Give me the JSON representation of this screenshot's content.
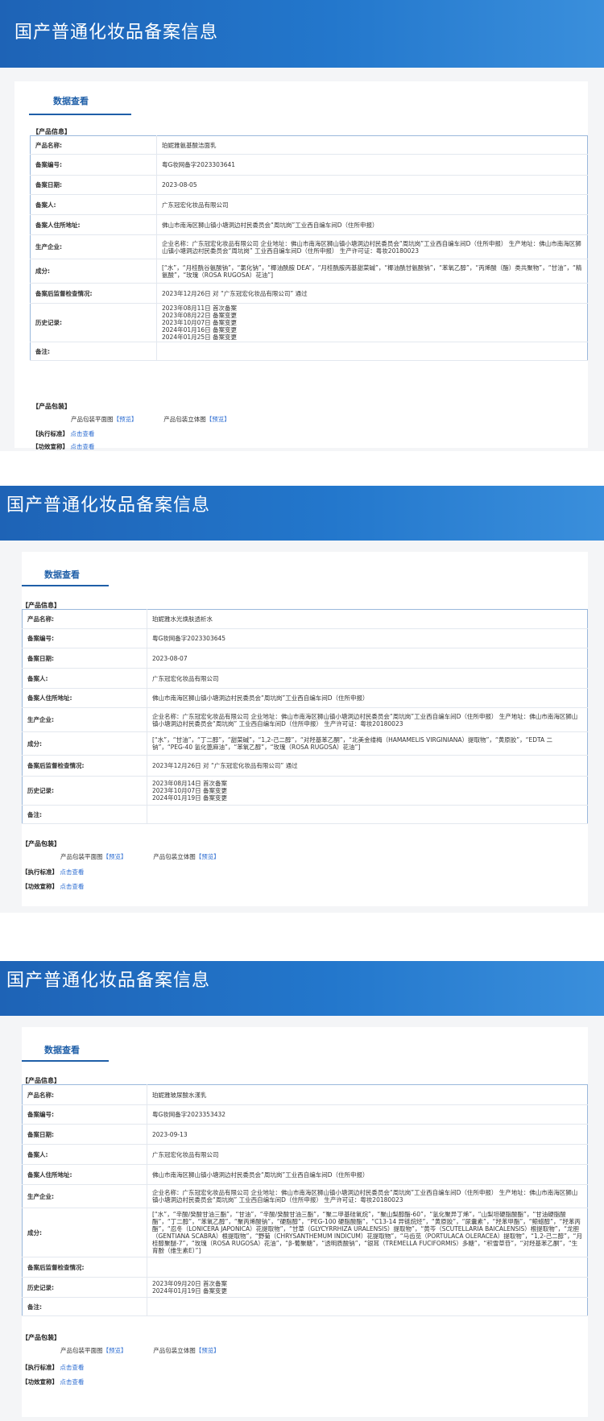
{
  "records": [
    {
      "header_title": "国产普通化妆品备案信息",
      "tab_label": "数据查看",
      "product_section": "【产品信息】",
      "rows": [
        {
          "label": "产品名称:",
          "value": "珀妮雅氨基酸洁面乳"
        },
        {
          "label": "备案编号:",
          "value": "粤G妆网备字2023303641"
        },
        {
          "label": "备案日期:",
          "value": "2023-08-05"
        },
        {
          "label": "备案人:",
          "value": "广东冠宏化妆品有限公司"
        },
        {
          "label": "备案人住所地址:",
          "value": "佛山市南海区狮山镇小塘洞边村民委员会“周坑岗”工业西自编车间D（住所申报）"
        },
        {
          "label": "生产企业:",
          "value": "企业名称：广东冠宏化妆品有限公司 企业地址：佛山市南海区狮山镇小塘洞边村民委员会“周坑岗”工业西自编车间D（住所申报） 生产地址：佛山市南海区狮山镇小塘洞边村民委员会“周坑岗” 工业西自编车间D（住所申报） 生产许可证：粤妆20180023"
        },
        {
          "label": "成分:",
          "value": "[“水”，“月桂酰谷氨酸钠”，“氯化钠”，“椰油酰胺 DEA”，“月桂酰胺丙基甜菜碱”，“椰油酰甘氨酸钠”，“苯氧乙醇”，“丙烯酸（酯）类共聚物”，“甘油”，“精氨酸”，“玫瑰（ROSA RUGOSA）花油”]"
        },
        {
          "label": "备案后监督检查情况:",
          "value": "2023年12月26日 对 “广东冠宏化妆品有限公司” 通过"
        },
        {
          "label": "历史记录:",
          "value": "2023年08月11日 首次备案\n2023年08月22日 备案变更\n2023年10月07日 备案变更\n2024年01月16日 备案变更\n2024年01月25日 备案变更"
        },
        {
          "label": "备注:",
          "value": ""
        }
      ],
      "package_section": "【产品包装】",
      "pkg_flat_label": "产品包装平面图",
      "pkg_flat_link": "【预览】",
      "pkg_3d_label": "产品包装立体图",
      "pkg_3d_link": "【预览】",
      "exec_label": "【执行标准】",
      "exec_link": "点击查看",
      "effect_label": "【功效宣称】",
      "effect_link": "点击查看"
    },
    {
      "header_title": "国产普通化妆品备案信息",
      "tab_label": "数据查看",
      "product_section": "【产品信息】",
      "rows": [
        {
          "label": "产品名称:",
          "value": "珀妮雅水光焕肤透析水"
        },
        {
          "label": "备案编号:",
          "value": "粤G妆网备字2023303645"
        },
        {
          "label": "备案日期:",
          "value": "2023-08-07"
        },
        {
          "label": "备案人:",
          "value": "广东冠宏化妆品有限公司"
        },
        {
          "label": "备案人住所地址:",
          "value": "佛山市南海区狮山镇小塘洞边村民委员会“周坑岗”工业西自编车间D（住所申报）"
        },
        {
          "label": "生产企业:",
          "value": "企业名称：广东冠宏化妆品有限公司 企业地址：佛山市南海区狮山镇小塘洞边村民委员会“周坑岗”工业西自编车间D（住所申报） 生产地址：佛山市南海区狮山镇小塘洞边村民委员会“周坑岗” 工业西自编车间D（住所申报） 生产许可证：粤妆20180023"
        },
        {
          "label": "成分:",
          "value": "[“水”，“甘油”，“丁二醇”，“甜菜碱”，“1,2-己二醇”，“对羟基苯乙酮”，“北美金缕梅（HAMAMELIS VIRGINIANA）提取物”，“黄原胶”，“EDTA 二钠”，“PEG-40 氢化蓖麻油”，“苯氧乙醇”，“玫瑰（ROSA RUGOSA）花油”]"
        },
        {
          "label": "备案后监督检查情况:",
          "value": "2023年12月26日 对 “广东冠宏化妆品有限公司” 通过"
        },
        {
          "label": "历史记录:",
          "value": "2023年08月14日 首次备案\n2023年10月07日 备案变更\n2024年01月19日 备案变更"
        },
        {
          "label": "备注:",
          "value": ""
        }
      ],
      "package_section": "【产品包装】",
      "pkg_flat_label": "产品包装平面图",
      "pkg_flat_link": "【预览】",
      "pkg_3d_label": "产品包装立体图",
      "pkg_3d_link": "【预览】",
      "exec_label": "【执行标准】",
      "exec_link": "点击查看",
      "effect_label": "【功效宣称】",
      "effect_link": "点击查看"
    },
    {
      "header_title": "国产普通化妆品备案信息",
      "tab_label": "数据查看",
      "product_section": "【产品信息】",
      "rows": [
        {
          "label": "产品名称:",
          "value": "珀妮雅玻尿酸水漾乳"
        },
        {
          "label": "备案编号:",
          "value": "粤G妆网备字2023353432"
        },
        {
          "label": "备案日期:",
          "value": "2023-09-13"
        },
        {
          "label": "备案人:",
          "value": "广东冠宏化妆品有限公司"
        },
        {
          "label": "备案人住所地址:",
          "value": "佛山市南海区狮山镇小塘洞边村民委员会“周坑岗”工业西自编车间D（住所申报）"
        },
        {
          "label": "生产企业:",
          "value": "企业名称：广东冠宏化妆品有限公司 企业地址：佛山市南海区狮山镇小塘洞边村民委员会“周坑岗”工业西自编车间D（住所申报） 生产地址：佛山市南海区狮山镇小塘洞边村民委员会“周坑岗” 工业西自编车间D（住所申报） 生产许可证：粤妆20180023"
        },
        {
          "label": "成分:",
          "value": "[“水”，“辛酸/癸酸甘油三酯”，“甘油”，“辛酸/癸酸甘油三酯”，“聚二甲基硅氧烷”，“聚山梨醇酯-60”，“氢化聚异丁烯”，“山梨坦硬脂酸酯”，“甘油硬脂酸酯”，“丁二醇”，“苯氧乙醇”，“聚丙烯酸钠”，“硬脂醇”，“PEG-100 硬脂酸酯”，“C13-14 异链烷烃”，“黄原胶”，“尿囊素”，“羟苯甲酯”，“鲸蜡醇”，“羟苯丙酯”，“忍冬（LONICERA JAPONICA）花提取物”，“甘草（GLYCYRRHIZA URALENSIS）提取物”，“黄芩（SCUTELLARIA BAICALENSIS）根提取物”，“龙胆（GENTIANA SCABRA）根提取物”，“野菊（CHRYSANTHEMUM INDICUM）花提取物”，“马齿苋（PORTULACA OLERACEA）提取物”，“1,2-己二醇”，“月桂醇聚醚-7”，“玫瑰（ROSA RUGOSA）花油”，“β-葡聚糖”，“透明质酸钠”，“银耳（TREMELLA FUCIFORMIS）多糖”，“积雪草苷”，“对羟基苯乙酮”，“生育酚（维生素E）”]"
        },
        {
          "label": "备案后监督检查情况:",
          "value": ""
        },
        {
          "label": "历史记录:",
          "value": "2023年09月20日 首次备案\n2024年01月19日 备案变更"
        },
        {
          "label": "备注:",
          "value": ""
        }
      ],
      "package_section": "【产品包装】",
      "pkg_flat_label": "产品包装平面图",
      "pkg_flat_link": "【预览】",
      "pkg_3d_label": "产品包装立体图",
      "pkg_3d_link": "【预览】",
      "exec_label": "【执行标准】",
      "exec_link": "点击查看",
      "effect_label": "【功效宣称】",
      "effect_link": "点击查看"
    }
  ]
}
